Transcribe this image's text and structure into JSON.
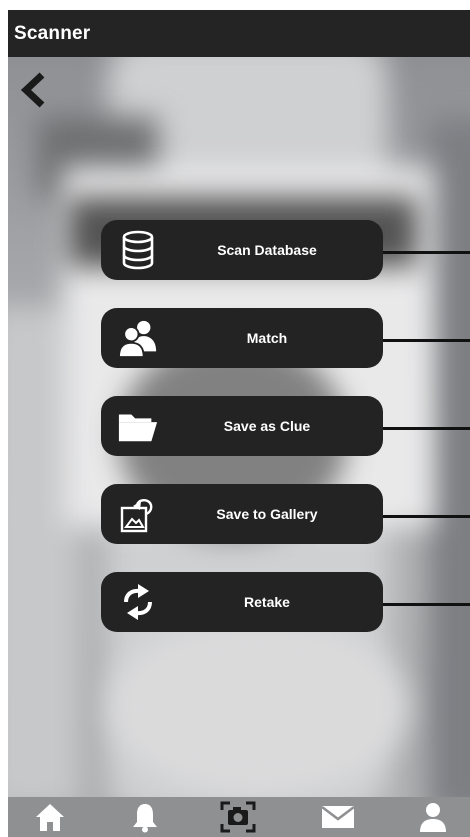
{
  "app_bar": {
    "title": "Scanner"
  },
  "actions": [
    {
      "label": "Scan Database",
      "icon": "database-icon"
    },
    {
      "label": "Match",
      "icon": "users-icon"
    },
    {
      "label": "Save as Clue",
      "icon": "folder-icon"
    },
    {
      "label": "Save to Gallery",
      "icon": "save-image-icon"
    },
    {
      "label": "Retake",
      "icon": "refresh-icon"
    }
  ],
  "bottom_nav": [
    {
      "name": "home",
      "icon": "home-icon"
    },
    {
      "name": "notifications",
      "icon": "bell-icon"
    },
    {
      "name": "scanner",
      "icon": "camera-scan-icon",
      "active": true
    },
    {
      "name": "messages",
      "icon": "mail-icon"
    },
    {
      "name": "profile",
      "icon": "user-icon"
    }
  ],
  "colors": {
    "bar": "#242424",
    "button": "#232323",
    "nav": "#8f9092",
    "icon": "#ffffff"
  }
}
